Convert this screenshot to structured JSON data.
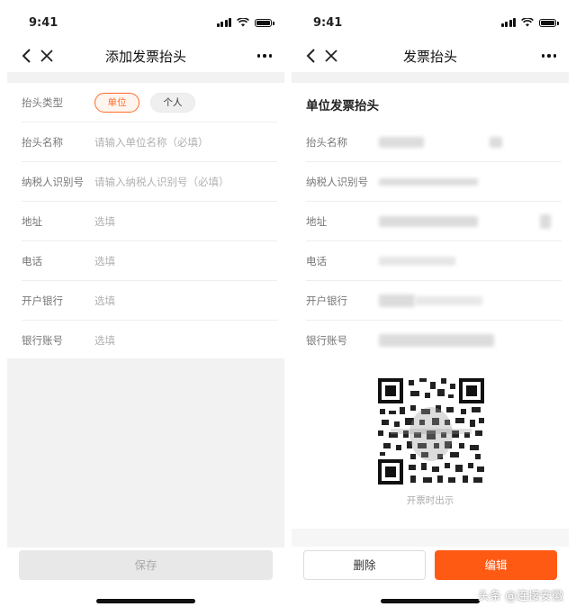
{
  "status_time": "9:41",
  "left": {
    "title": "添加发票抬头",
    "type_row": {
      "label": "抬头类型",
      "options": [
        "单位",
        "个人"
      ],
      "selected": "单位"
    },
    "rows": [
      {
        "label": "抬头名称",
        "placeholder": "请输入单位名称（必填）"
      },
      {
        "label": "纳税人识别号",
        "placeholder": "请输入纳税人识别号（必填）"
      },
      {
        "label": "地址",
        "placeholder": "选填"
      },
      {
        "label": "电话",
        "placeholder": "选填"
      },
      {
        "label": "开户银行",
        "placeholder": "选填"
      },
      {
        "label": "银行账号",
        "placeholder": "选填"
      }
    ],
    "save_label": "保存"
  },
  "right": {
    "title": "发票抬头",
    "section_title": "单位发票抬头",
    "rows": [
      {
        "label": "抬头名称"
      },
      {
        "label": "纳税人识别号"
      },
      {
        "label": "地址"
      },
      {
        "label": "电话"
      },
      {
        "label": "开户银行"
      },
      {
        "label": "银行账号"
      }
    ],
    "qr_caption": "开票时出示",
    "delete_label": "删除",
    "edit_label": "编辑"
  },
  "watermark": "头条 @连接安徽",
  "colors": {
    "accent": "#ff5a14",
    "chip_border": "#ff6a2a",
    "placeholder": "#b0b0b0",
    "band": "#f2f2f2"
  },
  "icons": [
    "back-icon",
    "close-icon",
    "more-icon",
    "signal-icon",
    "wifi-icon",
    "battery-icon",
    "qr-code-icon"
  ]
}
